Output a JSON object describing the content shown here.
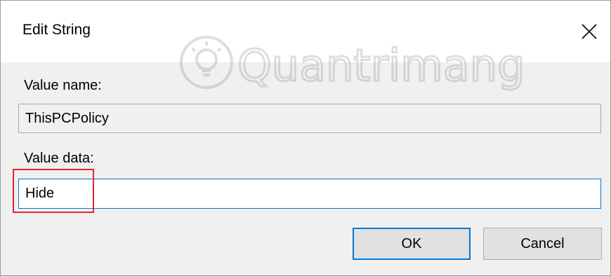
{
  "dialog": {
    "title": "Edit String",
    "close_icon": "close-icon",
    "watermark_text": "Quantrimang"
  },
  "value_name": {
    "label": "Value name:",
    "value": "ThisPCPolicy"
  },
  "value_data": {
    "label": "Value data:",
    "value": "Hide"
  },
  "buttons": {
    "ok_label": "OK",
    "cancel_label": "Cancel"
  },
  "colors": {
    "focus_accent": "#0078d7",
    "highlight_box": "#e8232f",
    "dialog_bg": "#f0f0f0"
  }
}
